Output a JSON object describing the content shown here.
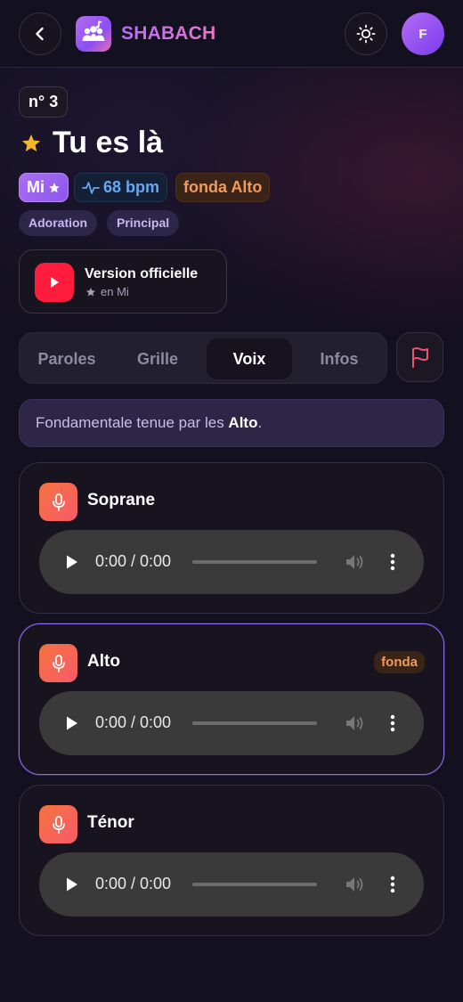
{
  "header": {
    "brand": "SHABACH",
    "avatar_initial": "F",
    "icons": [
      "chevron-left-icon",
      "music-group-logo",
      "sun-icon"
    ]
  },
  "song": {
    "number": "n° 3",
    "title": "Tu es là",
    "key": "Mi",
    "bpm": "68 bpm",
    "fonda": "fonda Alto",
    "tags": [
      "Adoration",
      "Principal"
    ]
  },
  "video": {
    "title": "Version officielle",
    "subtitle": "en Mi"
  },
  "tabs": [
    {
      "label": "Paroles",
      "active": false
    },
    {
      "label": "Grille",
      "active": false
    },
    {
      "label": "Voix",
      "active": true
    },
    {
      "label": "Infos",
      "active": false
    }
  ],
  "banner": {
    "prefix": "Fondamentale tenue par les ",
    "voice": "Alto",
    "suffix": "."
  },
  "voices": [
    {
      "name": "Soprane",
      "badge": "",
      "time": "0:00 / 0:00",
      "active": false
    },
    {
      "name": "Alto",
      "badge": "fonda",
      "time": "0:00 / 0:00",
      "active": true
    },
    {
      "name": "Ténor",
      "badge": "",
      "time": "0:00 / 0:00",
      "active": false
    }
  ],
  "colors": {
    "accent": "#8b55ec",
    "fonda": "#f19a5c",
    "bpm": "#67a8f3",
    "youtube": "#ff1c3d",
    "mic": "#f4733f",
    "star": "#f6b52a"
  }
}
